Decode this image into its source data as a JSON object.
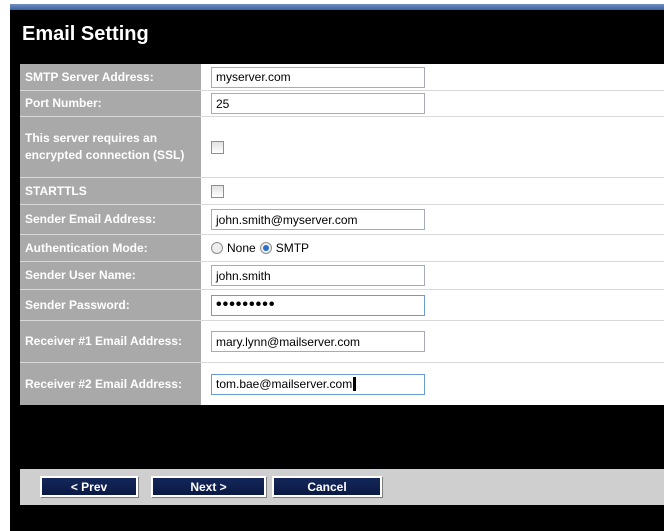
{
  "title": "Email Setting",
  "fields": {
    "smtp_server": {
      "label": "SMTP Server Address:",
      "value": "myserver.com"
    },
    "port": {
      "label": "Port Number:",
      "value": "25"
    },
    "ssl": {
      "label": "This server requires an encrypted connection (SSL)",
      "checked": false
    },
    "starttls": {
      "label": "STARTTLS",
      "checked": false
    },
    "sender_email": {
      "label": "Sender Email Address:",
      "value": "john.smith@myserver.com"
    },
    "auth_mode": {
      "label": "Authentication Mode:",
      "options": [
        "None",
        "SMTP"
      ],
      "selected": "SMTP"
    },
    "sender_user": {
      "label": "Sender User Name:",
      "value": "john.smith"
    },
    "sender_password": {
      "label": "Sender Password:",
      "value": "•••••••••"
    },
    "receiver1": {
      "label": "Receiver #1 Email Address:",
      "value": "mary.lynn@mailserver.com"
    },
    "receiver2": {
      "label": "Receiver #2 Email Address:",
      "value": "tom.bae@mailserver.com"
    }
  },
  "buttons": {
    "prev": "< Prev",
    "next": "Next >",
    "cancel": "Cancel"
  }
}
